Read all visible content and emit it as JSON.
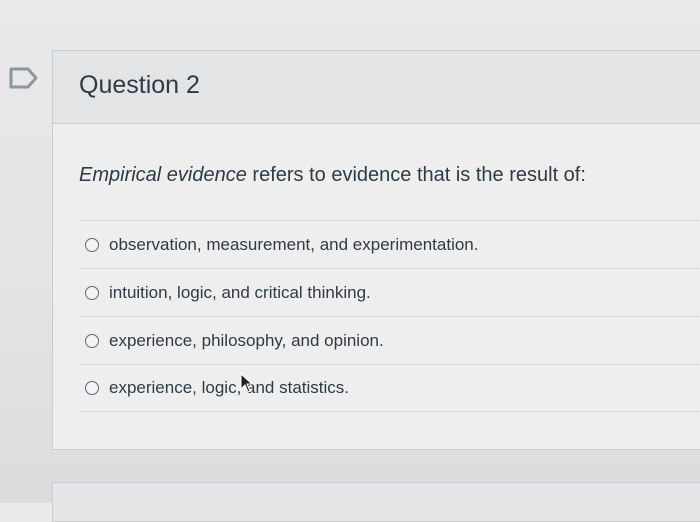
{
  "question": {
    "title": "Question 2",
    "prompt_emphasis": "Empirical evidence",
    "prompt_rest": " refers to evidence that is the result of:",
    "answers": [
      {
        "label": "observation, measurement, and experimentation."
      },
      {
        "label": "intuition, logic, and critical thinking."
      },
      {
        "label": "experience, philosophy, and opinion."
      },
      {
        "label": "experience, logic, and statistics."
      }
    ]
  },
  "icons": {
    "bookmark": "bookmark-flag-icon",
    "radio": "radio-button-icon",
    "cursor": "mouse-pointer-icon"
  },
  "colors": {
    "text": "#2d3b45",
    "border": "#c7cdd1",
    "header_bg": "#e3e4e6"
  }
}
